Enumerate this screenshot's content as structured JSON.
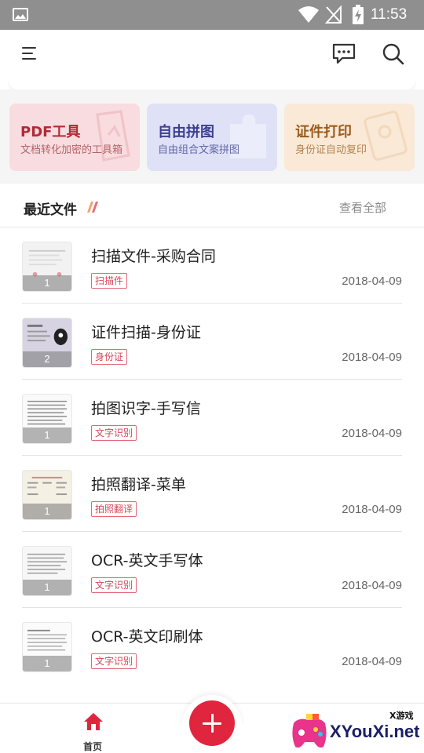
{
  "status_bar": {
    "time": "11:53",
    "icons": [
      "image-icon",
      "wifi-icon",
      "no-signal-icon",
      "battery-charging-icon"
    ]
  },
  "header": {
    "icons": [
      "menu-icon",
      "chat-icon",
      "search-icon"
    ]
  },
  "tools": [
    {
      "title": "PDF工具",
      "subtitle": "文档转化加密的工具箱",
      "color": "#b22a36"
    },
    {
      "title": "自由拼图",
      "subtitle": "自由组合文案拼图",
      "color": "#3c3f8f"
    },
    {
      "title": "证件打印",
      "subtitle": "身份证自动复印",
      "color": "#9a5b1e"
    }
  ],
  "recent": {
    "title": "最近文件",
    "view_all": "查看全部"
  },
  "files": [
    {
      "name": "扫描文件-采购合同",
      "tag": "扫描件",
      "date": "2018-04-09",
      "pages": "1"
    },
    {
      "name": "证件扫描-身份证",
      "tag": "身份证",
      "date": "2018-04-09",
      "pages": "2"
    },
    {
      "name": "拍图识字-手写信",
      "tag": "文字识别",
      "date": "2018-04-09",
      "pages": "1"
    },
    {
      "name": "拍照翻译-菜单",
      "tag": "拍照翻译",
      "date": "2018-04-09",
      "pages": "1"
    },
    {
      "name": "OCR-英文手写体",
      "tag": "文字识别",
      "date": "2018-04-09",
      "pages": "1"
    },
    {
      "name": "OCR-英文印刷体",
      "tag": "文字识别",
      "date": "2018-04-09",
      "pages": "1"
    }
  ],
  "bottom_nav": {
    "home_label": "首页",
    "accent": "#e0253e"
  },
  "watermark": {
    "small": "X游戏",
    "big": "XYouXi.net"
  }
}
